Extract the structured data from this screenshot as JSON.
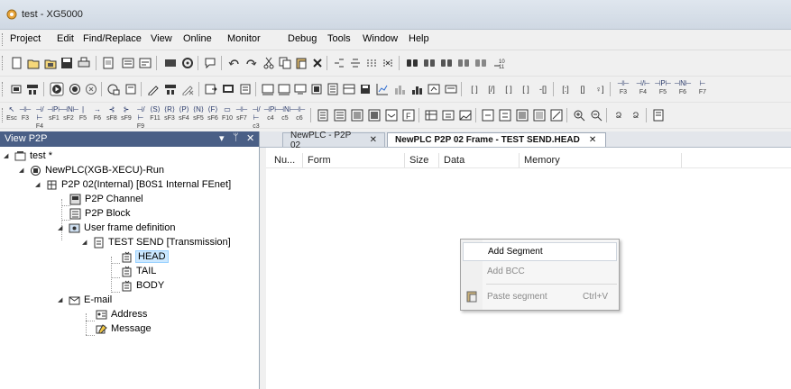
{
  "window": {
    "title": "test - XG5000"
  },
  "menubar": {
    "items": [
      "Project",
      "Edit",
      "Find/Replace",
      "View",
      "Online",
      "Monitor",
      "Debug",
      "Tools",
      "Window",
      "Help"
    ]
  },
  "toolbar3": {
    "fkeys": [
      {
        "sym": "⊣⊢",
        "label": "F3"
      },
      {
        "sym": "⊣/⊢",
        "label": "F4"
      },
      {
        "sym": "⊣P⊢",
        "label": "F5"
      },
      {
        "sym": "⊣N⊢",
        "label": "F6"
      },
      {
        "sym": "⊢",
        "label": "F7"
      }
    ]
  },
  "toolbar4": {
    "fkeys": [
      {
        "sym": "⊣⊢",
        "label": "F3"
      },
      {
        "sym": "⊣/⊢",
        "label": "F4"
      },
      {
        "sym": "⊣P⊢",
        "label": "sF1"
      },
      {
        "sym": "⊣N⊢",
        "label": "sF2"
      },
      {
        "sym": "|",
        "label": "F5"
      },
      {
        "sym": "→",
        "label": "F6"
      },
      {
        "sym": "⊰",
        "label": "sF8"
      },
      {
        "sym": "⊱",
        "label": "sF9"
      },
      {
        "sym": "⊣/⊢",
        "label": "F9"
      },
      {
        "sym": "⟨S⟩",
        "label": "F11"
      },
      {
        "sym": "⟨R⟩",
        "label": "sF3"
      },
      {
        "sym": "⟨P⟩",
        "label": "sF4"
      },
      {
        "sym": "⟨N⟩",
        "label": "sF5"
      },
      {
        "sym": "⟨F⟩",
        "label": "sF6"
      },
      {
        "sym": "▭",
        "label": "F10"
      },
      {
        "sym": "⊣⊢",
        "label": "sF7"
      },
      {
        "sym": "⊣/⊢",
        "label": "c3"
      },
      {
        "sym": "⊣P⊢",
        "label": "c4"
      },
      {
        "sym": "⊣N⊢",
        "label": "c5"
      },
      {
        "sym": "⊣⊢",
        "label": "c6"
      }
    ]
  },
  "left_panel": {
    "title": "View P2P",
    "pin_symbol": "▾ ⊕ ✕",
    "tree": [
      {
        "label": "test *",
        "icon": "project-icon"
      },
      {
        "label": "NewPLC(XGB-XECU)-Run",
        "icon": "plc-icon"
      },
      {
        "label": "P2P 02(Internal) [B0S1 Internal FEnet]",
        "icon": "p2p-icon"
      },
      {
        "label": "P2P Channel",
        "icon": "channel-icon"
      },
      {
        "label": "P2P Block",
        "icon": "block-icon"
      },
      {
        "label": "User frame definition",
        "icon": "frame-definition-icon"
      },
      {
        "label": "TEST SEND [Transmission]",
        "icon": "transmission-icon"
      },
      {
        "label": "HEAD",
        "icon": "frame-icon"
      },
      {
        "label": "TAIL",
        "icon": "frame-icon"
      },
      {
        "label": "BODY",
        "icon": "frame-icon"
      },
      {
        "label": "E-mail",
        "icon": "email-icon"
      },
      {
        "label": "Address",
        "icon": "address-icon"
      },
      {
        "label": "Message",
        "icon": "message-icon"
      }
    ]
  },
  "tabs": [
    {
      "label": "NewPLC - P2P 02",
      "close": "✕",
      "active": false
    },
    {
      "label": "NewPLC P2P 02 Frame - TEST SEND.HEAD",
      "close": "✕",
      "active": true
    }
  ],
  "table": {
    "columns": [
      "Nu...",
      "Form",
      "Size",
      "Data",
      "Memory"
    ]
  },
  "context_menu": {
    "items": [
      {
        "label": "Add Segment",
        "shortcut": "",
        "state": "highlighted"
      },
      {
        "label": "Add BCC",
        "shortcut": "",
        "state": "disabled"
      },
      {
        "label": "Paste segment",
        "shortcut": "Ctrl+V",
        "state": "disabled",
        "icon": "paste-icon"
      }
    ]
  }
}
